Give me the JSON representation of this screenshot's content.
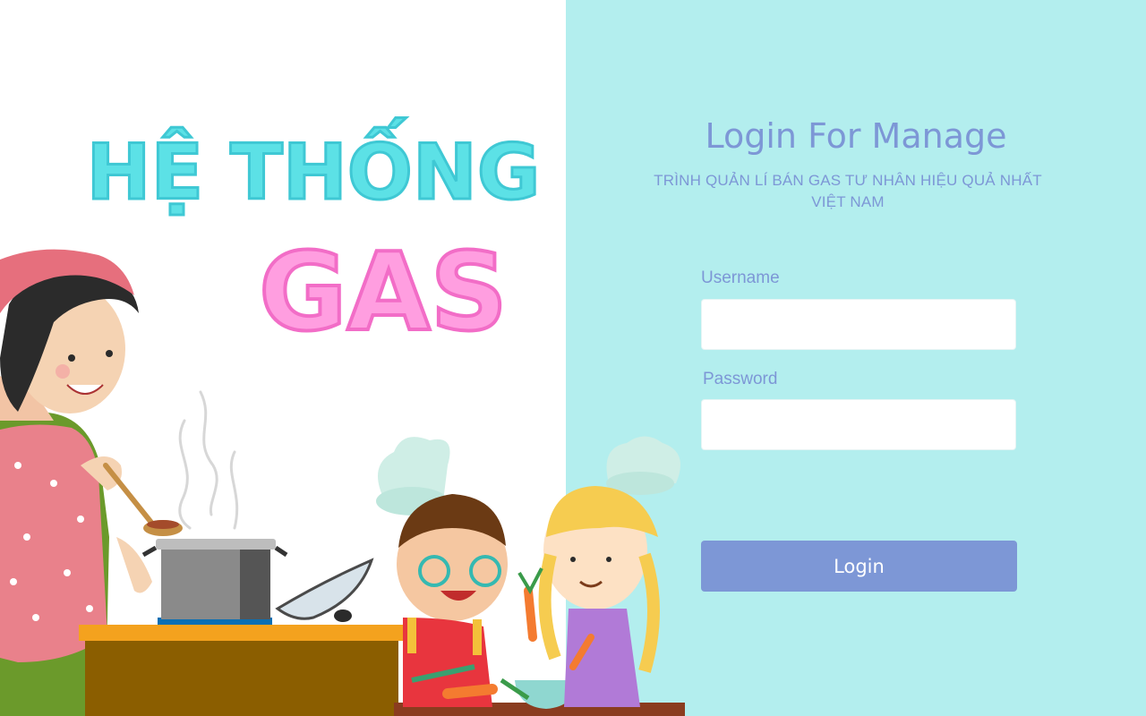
{
  "brand": {
    "line1": "HỆ THỐNG",
    "line2": "GAS"
  },
  "login": {
    "title": "Login For Manage",
    "subtitle": "TRÌNH QUẢN LÍ BÁN GAS TƯ NHÂN HIỆU QUẢ NHẤT VIỆT NAM",
    "username_label": "Username",
    "username_value": "",
    "password_label": "Password",
    "password_value": "",
    "button_label": "Login"
  },
  "colors": {
    "panel_bg": "#b3eeee",
    "accent": "#7d97d6",
    "brand_cyan": "#5ce1e6",
    "brand_pink": "#ff9ee0"
  }
}
